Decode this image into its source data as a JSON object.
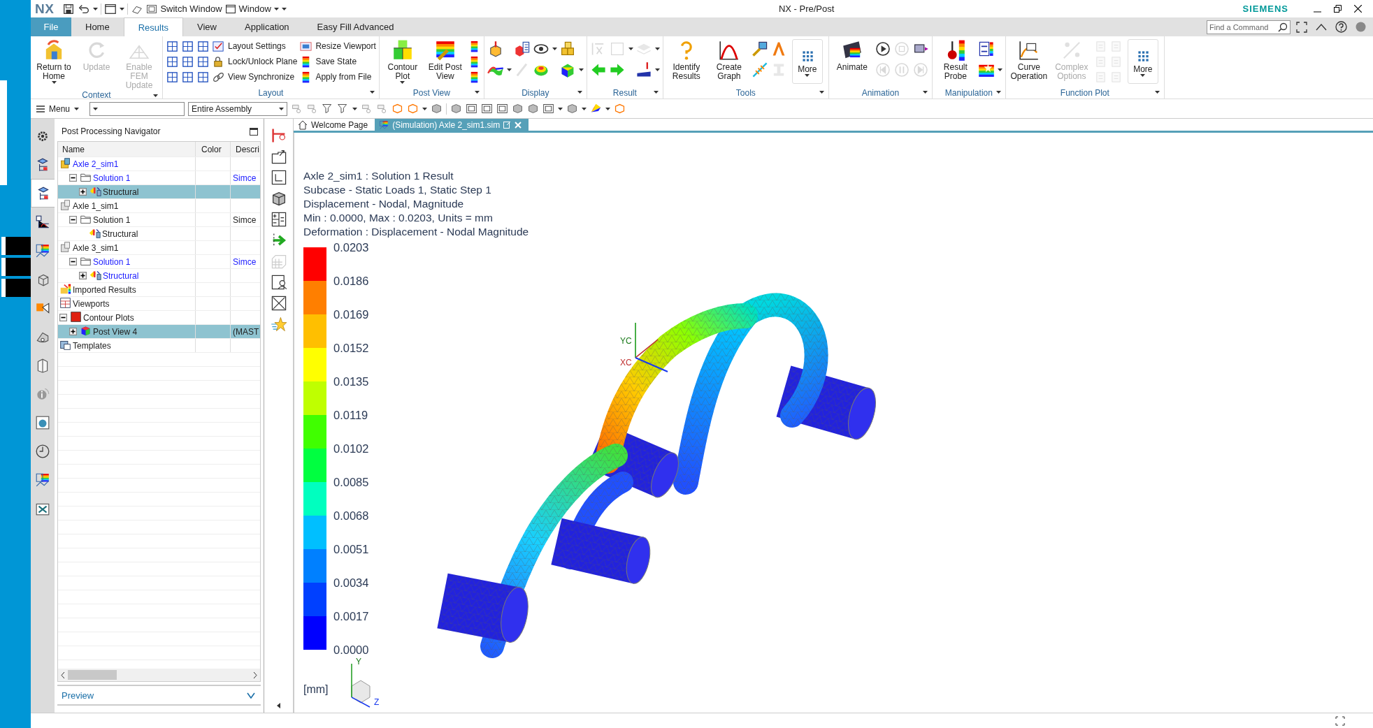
{
  "title_bar": {
    "logo": "NX",
    "quick_access": [
      {
        "label": "Switch Window",
        "dropdown": false
      },
      {
        "label": "Window",
        "dropdown": true
      }
    ],
    "title": "NX - Pre/Post",
    "brand": "SIEMENS"
  },
  "tabs": [
    {
      "label": "File",
      "kind": "menu",
      "selected": false
    },
    {
      "label": "Home",
      "kind": "tab",
      "selected": false
    },
    {
      "label": "Results",
      "kind": "tab",
      "selected": true
    },
    {
      "label": "View",
      "kind": "tab",
      "selected": false
    },
    {
      "label": "Application",
      "kind": "tab",
      "selected": false
    },
    {
      "label": "Easy Fill Advanced",
      "kind": "tab",
      "selected": false
    }
  ],
  "command_search": {
    "placeholder": "Find a Command"
  },
  "ribbon": [
    {
      "label": "Context",
      "columns": [
        {
          "kind": "large",
          "label": "Return to Home",
          "dropdown": true,
          "disabled": false
        },
        {
          "kind": "large",
          "label": "Update",
          "dropdown": false,
          "disabled": true
        },
        {
          "kind": "large",
          "label": "Enable FEM Update",
          "dropdown": false,
          "disabled": true
        }
      ]
    },
    {
      "label": "Layout",
      "columns": [
        {
          "kind": "stack",
          "items": [
            {
              "disabled": false,
              "dropdown": false
            },
            {
              "disabled": false,
              "dropdown": false
            },
            {
              "disabled": false,
              "dropdown": false
            }
          ]
        },
        {
          "kind": "stack",
          "items": [
            {
              "disabled": false,
              "dropdown": false
            },
            {
              "disabled": false,
              "dropdown": false
            },
            {
              "disabled": false,
              "dropdown": false
            }
          ]
        },
        {
          "kind": "stack",
          "items": [
            {
              "disabled": false,
              "dropdown": false
            },
            {
              "disabled": false,
              "dropdown": false
            },
            {
              "disabled": false,
              "dropdown": false
            }
          ]
        },
        {
          "kind": "stack",
          "items": [
            {
              "label": "Layout Settings",
              "disabled": false,
              "dropdown": false
            },
            {
              "label": "Lock/Unlock Plane",
              "disabled": false,
              "dropdown": false
            },
            {
              "label": "View Synchronize",
              "disabled": false,
              "dropdown": false
            }
          ]
        },
        {
          "kind": "stack",
          "items": [
            {
              "label": "Resize Viewport",
              "disabled": false,
              "dropdown": false
            },
            {
              "label": "Save State",
              "disabled": false,
              "dropdown": false
            },
            {
              "label": "Apply from File",
              "disabled": false,
              "dropdown": false
            }
          ]
        }
      ]
    },
    {
      "label": "Post View",
      "columns": [
        {
          "kind": "large",
          "label": "Contour Plot",
          "dropdown": true,
          "disabled": false
        },
        {
          "kind": "large",
          "label": "Edit Post View",
          "dropdown": false,
          "disabled": false
        },
        {
          "kind": "stack",
          "items": [
            {
              "disabled": false,
              "dropdown": false
            },
            {
              "disabled": false,
              "dropdown": false
            },
            {
              "disabled": false,
              "dropdown": false
            }
          ]
        }
      ]
    },
    {
      "label": "Display",
      "columns": [
        {
          "kind": "stack",
          "items": [
            {
              "disabled": false,
              "dropdown": false
            },
            {
              "disabled": false,
              "dropdown": true
            }
          ]
        },
        {
          "kind": "stack",
          "items": [
            {
              "disabled": false,
              "dropdown": false
            },
            {
              "disabled": true,
              "dropdown": false
            }
          ]
        },
        {
          "kind": "stack",
          "items": [
            {
              "disabled": false,
              "dropdown": true
            },
            {
              "disabled": false,
              "dropdown": false
            }
          ]
        },
        {
          "kind": "stack",
          "items": [
            {
              "disabled": false,
              "dropdown": false
            },
            {
              "disabled": false,
              "dropdown": true
            }
          ]
        }
      ]
    },
    {
      "label": "Result",
      "columns": [
        {
          "kind": "stack",
          "items": [
            {
              "disabled": true,
              "dropdown": false
            },
            {
              "disabled": false,
              "dropdown": false
            }
          ]
        },
        {
          "kind": "stack",
          "items": [
            {
              "disabled": true,
              "dropdown": true
            },
            {
              "disabled": false,
              "dropdown": false
            }
          ]
        },
        {
          "kind": "stack",
          "items": [
            {
              "disabled": true,
              "dropdown": true
            },
            {
              "disabled": false,
              "dropdown": true
            }
          ]
        }
      ]
    },
    {
      "label": "Tools",
      "columns": [
        {
          "kind": "large",
          "label": "Identify Results",
          "dropdown": false,
          "disabled": false
        },
        {
          "kind": "large",
          "label": "Create Graph",
          "dropdown": false,
          "disabled": false
        },
        {
          "kind": "stack",
          "items": [
            {
              "disabled": false,
              "dropdown": false
            },
            {
              "disabled": false,
              "dropdown": false
            }
          ]
        },
        {
          "kind": "stack",
          "items": [
            {
              "disabled": false,
              "dropdown": false
            },
            {
              "disabled": true,
              "dropdown": false
            }
          ]
        },
        {
          "kind": "more",
          "label": "More",
          "dropdown": true,
          "disabled": false
        }
      ]
    },
    {
      "label": "Animation",
      "columns": [
        {
          "kind": "large",
          "label": "Animate",
          "dropdown": false,
          "disabled": false
        },
        {
          "kind": "stack",
          "items": [
            {
              "disabled": false,
              "dropdown": false
            },
            {
              "disabled": true,
              "dropdown": false
            }
          ]
        },
        {
          "kind": "stack",
          "items": [
            {
              "disabled": true,
              "dropdown": false
            },
            {
              "disabled": true,
              "dropdown": false
            }
          ]
        },
        {
          "kind": "stack",
          "items": [
            {
              "disabled": false,
              "dropdown": false
            },
            {
              "disabled": true,
              "dropdown": false
            }
          ]
        }
      ]
    },
    {
      "label": "Manipulation",
      "columns": [
        {
          "kind": "large",
          "label": "Result Probe",
          "dropdown": false,
          "disabled": false
        },
        {
          "kind": "stack",
          "items": [
            {
              "disabled": false,
              "dropdown": false
            },
            {
              "disabled": false,
              "dropdown": true
            }
          ]
        }
      ]
    },
    {
      "label": "Function Plot",
      "columns": [
        {
          "kind": "large",
          "label": "Curve Operation",
          "dropdown": false,
          "disabled": false
        },
        {
          "kind": "large",
          "label": "Complex Options",
          "dropdown": false,
          "disabled": true
        },
        {
          "kind": "stack",
          "items": [
            {
              "disabled": true,
              "dropdown": false
            },
            {
              "disabled": true,
              "dropdown": false
            },
            {
              "disabled": true,
              "dropdown": false
            }
          ]
        },
        {
          "kind": "stack",
          "items": [
            {
              "disabled": true,
              "dropdown": false
            },
            {
              "disabled": true,
              "dropdown": false
            },
            {
              "disabled": true,
              "dropdown": false
            }
          ]
        },
        {
          "kind": "more",
          "label": "More",
          "dropdown": true,
          "disabled": false
        }
      ]
    }
  ],
  "toolbar": {
    "menu": "Menu",
    "scope_value": "Entire Assembly"
  },
  "resource_bar": [
    {
      "selected": false
    },
    {
      "selected": false
    },
    {
      "selected": true
    },
    {
      "selected": false
    },
    {
      "selected": false
    },
    {
      "selected": false
    },
    {
      "selected": false
    },
    {
      "selected": false
    },
    {
      "selected": false
    },
    {
      "selected": false
    },
    {
      "selected": false
    },
    {
      "selected": false
    },
    {
      "selected": false
    },
    {
      "selected": false
    }
  ],
  "navigator": {
    "title": "Post Processing Navigator",
    "columns": [
      "Name",
      "Color",
      "Descri"
    ],
    "nodes": [
      {
        "label": "Axle 2_sim1",
        "kind": "simulation",
        "active": true,
        "selected": false,
        "expandable": false,
        "expanded": true,
        "children": [
          {
            "label": "Solution 1",
            "kind": "solution",
            "active": true,
            "selected": false,
            "expandable": true,
            "expanded": true,
            "description": "Simce",
            "children": [
              {
                "label": "Structural",
                "kind": "result",
                "active": false,
                "selected": true,
                "expandable": true,
                "expanded": false
              }
            ]
          }
        ]
      },
      {
        "label": "Axle 1_sim1",
        "kind": "simulation",
        "active": false,
        "selected": false,
        "expandable": false,
        "expanded": true,
        "children": [
          {
            "label": "Solution 1",
            "kind": "solution",
            "active": false,
            "selected": false,
            "expandable": true,
            "expanded": true,
            "description": "Simce",
            "children": [
              {
                "label": "Structural",
                "kind": "result",
                "active": false,
                "selected": false,
                "expandable": false
              }
            ]
          }
        ]
      },
      {
        "label": "Axle 3_sim1",
        "kind": "simulation",
        "active": false,
        "selected": false,
        "expandable": false,
        "expanded": true,
        "children": [
          {
            "label": "Solution 1",
            "kind": "solution",
            "active": true,
            "selected": false,
            "expandable": true,
            "expanded": true,
            "description": "Simce",
            "children": [
              {
                "label": "Structural",
                "kind": "result",
                "active": true,
                "selected": false,
                "expandable": true,
                "expanded": false
              }
            ]
          }
        ]
      },
      {
        "label": "Imported Results",
        "kind": "imported",
        "active": false,
        "selected": false,
        "expandable": false
      },
      {
        "label": "Viewports",
        "kind": "viewports",
        "active": false,
        "selected": false,
        "expandable": false
      },
      {
        "label": "Contour Plots",
        "kind": "contour",
        "active": false,
        "selected": false,
        "expandable": true,
        "expanded": true,
        "children": [
          {
            "label": "Post View 4",
            "kind": "postview",
            "active": false,
            "selected": true,
            "expandable": true,
            "expanded": false,
            "description": "(MAST"
          }
        ]
      },
      {
        "label": "Templates",
        "kind": "templates",
        "active": false,
        "selected": false,
        "expandable": false
      }
    ],
    "footer": "Preview"
  },
  "document_tabs": [
    {
      "label": "Welcome Page",
      "selected": false
    },
    {
      "label": "(Simulation) Axle 2_sim1.sim",
      "selected": true
    }
  ],
  "viewport": {
    "info": [
      "Axle 2_sim1 : Solution 1 Result",
      "Subcase - Static Loads 1, Static Step 1",
      "Displacement - Nodal, Magnitude",
      "Min : 0.0000, Max : 0.0203, Units = mm",
      "Deformation : Displacement - Nodal Magnitude"
    ],
    "legend": {
      "labels": [
        "0.0203",
        "0.0186",
        "0.0169",
        "0.0152",
        "0.0135",
        "0.0119",
        "0.0102",
        "0.0085",
        "0.0068",
        "0.0051",
        "0.0034",
        "0.0017",
        "0.0000"
      ],
      "bands": [
        {
          "color": "#ff0000"
        },
        {
          "color": "#ff7f00"
        },
        {
          "color": "#ffbf00"
        },
        {
          "color": "#ffff00"
        },
        {
          "color": "#bfff00"
        },
        {
          "color": "#40ff00"
        },
        {
          "color": "#00ff40"
        },
        {
          "color": "#00ffbf"
        },
        {
          "color": "#00bfff"
        },
        {
          "color": "#0080ff"
        },
        {
          "color": "#0040ff"
        },
        {
          "color": "#0000ff"
        }
      ],
      "unit": "[mm]"
    },
    "model_triad": [
      "YC",
      "XC"
    ],
    "view_triad": [
      "Y",
      "Z"
    ]
  }
}
